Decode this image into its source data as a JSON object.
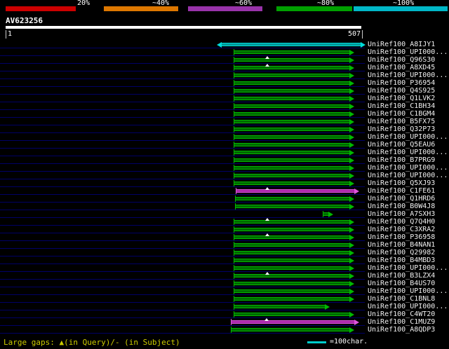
{
  "palette": {
    "background": "#000000",
    "grid_line": "#000066",
    "query_bar": "#ffffff",
    "label_text": "#f0f0f0",
    "footer_text": "#cccc00",
    "unit_line": "#00cccc",
    "hit_colors": {
      "green": {
        "fill": "#006a00",
        "edge": "#00b800"
      },
      "cyan": {
        "fill": "#009a9a",
        "edge": "#00dcdc"
      },
      "magenta": {
        "fill": "#a928a9",
        "edge": "#dd55dd"
      }
    }
  },
  "query": {
    "name": "AV623256",
    "start": "1",
    "end": "507"
  },
  "footer": {
    "large_gaps_legend": "Large gaps: ▲(in Query)/- (in Subject)",
    "unit_legend": "=100char."
  },
  "chart_data": {
    "type": "bar",
    "title": "AV623256",
    "xlabel": "query position",
    "x_range": [
      1,
      507
    ],
    "legend_position": "top",
    "color_key": [
      {
        "label": "20%",
        "color": "#cc0000"
      },
      {
        "label": "~40%",
        "color": "#dd7700"
      },
      {
        "label": "~60%",
        "color": "#9933aa"
      },
      {
        "label": "~80%",
        "color": "#00a000"
      },
      {
        "label": "~100%",
        "color": "#00b7c7"
      }
    ],
    "rows": [
      {
        "name": "UniRef100_A8IJY1",
        "color": "cyan",
        "start": 309,
        "end": 507,
        "arrows": "both",
        "gaps": []
      },
      {
        "name": "UniRef100_UPI000...",
        "color": "green",
        "start": 327,
        "end": 491,
        "arrows": "right",
        "gaps": []
      },
      {
        "name": "UniRef100_Q96S30",
        "color": "green",
        "start": 327,
        "end": 491,
        "arrows": "right",
        "gaps": [
          374
        ]
      },
      {
        "name": "UniRef100_A8XD45",
        "color": "green",
        "start": 327,
        "end": 491,
        "arrows": "right",
        "gaps": [
          374
        ]
      },
      {
        "name": "UniRef100_UPI000...",
        "color": "green",
        "start": 327,
        "end": 491,
        "arrows": "right",
        "gaps": []
      },
      {
        "name": "UniRef100_P36954",
        "color": "green",
        "start": 327,
        "end": 491,
        "arrows": "right",
        "gaps": []
      },
      {
        "name": "UniRef100_Q4S925",
        "color": "green",
        "start": 327,
        "end": 491,
        "arrows": "right",
        "gaps": []
      },
      {
        "name": "UniRef100_Q1LVK2",
        "color": "green",
        "start": 327,
        "end": 491,
        "arrows": "right",
        "gaps": []
      },
      {
        "name": "UniRef100_C1BH34",
        "color": "green",
        "start": 327,
        "end": 491,
        "arrows": "right",
        "gaps": []
      },
      {
        "name": "UniRef100_C1BGM4",
        "color": "green",
        "start": 327,
        "end": 491,
        "arrows": "right",
        "gaps": []
      },
      {
        "name": "UniRef100_B5FX75",
        "color": "green",
        "start": 327,
        "end": 491,
        "arrows": "right",
        "gaps": []
      },
      {
        "name": "UniRef100_Q32P73",
        "color": "green",
        "start": 327,
        "end": 491,
        "arrows": "right",
        "gaps": []
      },
      {
        "name": "UniRef100_UPI000...",
        "color": "green",
        "start": 327,
        "end": 491,
        "arrows": "right",
        "gaps": []
      },
      {
        "name": "UniRef100_Q5EAU6",
        "color": "green",
        "start": 327,
        "end": 491,
        "arrows": "right",
        "gaps": []
      },
      {
        "name": "UniRef100_UPI000...",
        "color": "green",
        "start": 327,
        "end": 491,
        "arrows": "right",
        "gaps": []
      },
      {
        "name": "UniRef100_B7PRG9",
        "color": "green",
        "start": 327,
        "end": 491,
        "arrows": "right",
        "gaps": []
      },
      {
        "name": "UniRef100_UPI000...",
        "color": "green",
        "start": 327,
        "end": 491,
        "arrows": "right",
        "gaps": []
      },
      {
        "name": "UniRef100_UPI000...",
        "color": "green",
        "start": 327,
        "end": 491,
        "arrows": "right",
        "gaps": []
      },
      {
        "name": "UniRef100_Q5XJ93",
        "color": "green",
        "start": 327,
        "end": 491,
        "arrows": "right",
        "gaps": []
      },
      {
        "name": "UniRef100_C1FE61",
        "color": "magenta",
        "start": 330,
        "end": 498,
        "arrows": "right",
        "gaps": [
          374
        ]
      },
      {
        "name": "UniRef100_Q1HRD6",
        "color": "green",
        "start": 329,
        "end": 491,
        "arrows": "right",
        "gaps": []
      },
      {
        "name": "UniRef100_B0W4J8",
        "color": "green",
        "start": 329,
        "end": 491,
        "arrows": "right",
        "gaps": []
      },
      {
        "name": "UniRef100_A7SXH3",
        "color": "green",
        "start": 454,
        "end": 461,
        "arrows": "right",
        "gaps": []
      },
      {
        "name": "UniRef100_Q7Q4H0",
        "color": "green",
        "start": 327,
        "end": 491,
        "arrows": "right",
        "gaps": [
          374
        ]
      },
      {
        "name": "UniRef100_C3XRA2",
        "color": "green",
        "start": 327,
        "end": 491,
        "arrows": "right",
        "gaps": []
      },
      {
        "name": "UniRef100_P36958",
        "color": "green",
        "start": 327,
        "end": 491,
        "arrows": "right",
        "gaps": [
          374
        ]
      },
      {
        "name": "UniRef100_B4NAN1",
        "color": "green",
        "start": 327,
        "end": 491,
        "arrows": "right",
        "gaps": []
      },
      {
        "name": "UniRef100_Q29982",
        "color": "green",
        "start": 327,
        "end": 491,
        "arrows": "right",
        "gaps": []
      },
      {
        "name": "UniRef100_B4MBD3",
        "color": "green",
        "start": 327,
        "end": 491,
        "arrows": "right",
        "gaps": []
      },
      {
        "name": "UniRef100_UPI000...",
        "color": "green",
        "start": 327,
        "end": 491,
        "arrows": "right",
        "gaps": []
      },
      {
        "name": "UniRef100_B3LZX4",
        "color": "green",
        "start": 327,
        "end": 491,
        "arrows": "right",
        "gaps": [
          374
        ]
      },
      {
        "name": "UniRef100_B4US70",
        "color": "green",
        "start": 327,
        "end": 491,
        "arrows": "right",
        "gaps": []
      },
      {
        "name": "UniRef100_UPI000...",
        "color": "green",
        "start": 327,
        "end": 491,
        "arrows": "right",
        "gaps": []
      },
      {
        "name": "UniRef100_C1BNL8",
        "color": "green",
        "start": 327,
        "end": 491,
        "arrows": "right",
        "gaps": []
      },
      {
        "name": "UniRef100_UPI000...",
        "color": "green",
        "start": 327,
        "end": 456,
        "arrows": "right",
        "gaps": []
      },
      {
        "name": "UniRef100_C4WT20",
        "color": "green",
        "start": 327,
        "end": 491,
        "arrows": "right",
        "gaps": []
      },
      {
        "name": "UniRef100_C1MUZ9",
        "color": "magenta",
        "start": 323,
        "end": 498,
        "arrows": "right",
        "gaps": [
          373
        ]
      },
      {
        "name": "UniRef100_A8QDP3",
        "color": "green",
        "start": 323,
        "end": 491,
        "arrows": "right",
        "gaps": []
      }
    ]
  }
}
